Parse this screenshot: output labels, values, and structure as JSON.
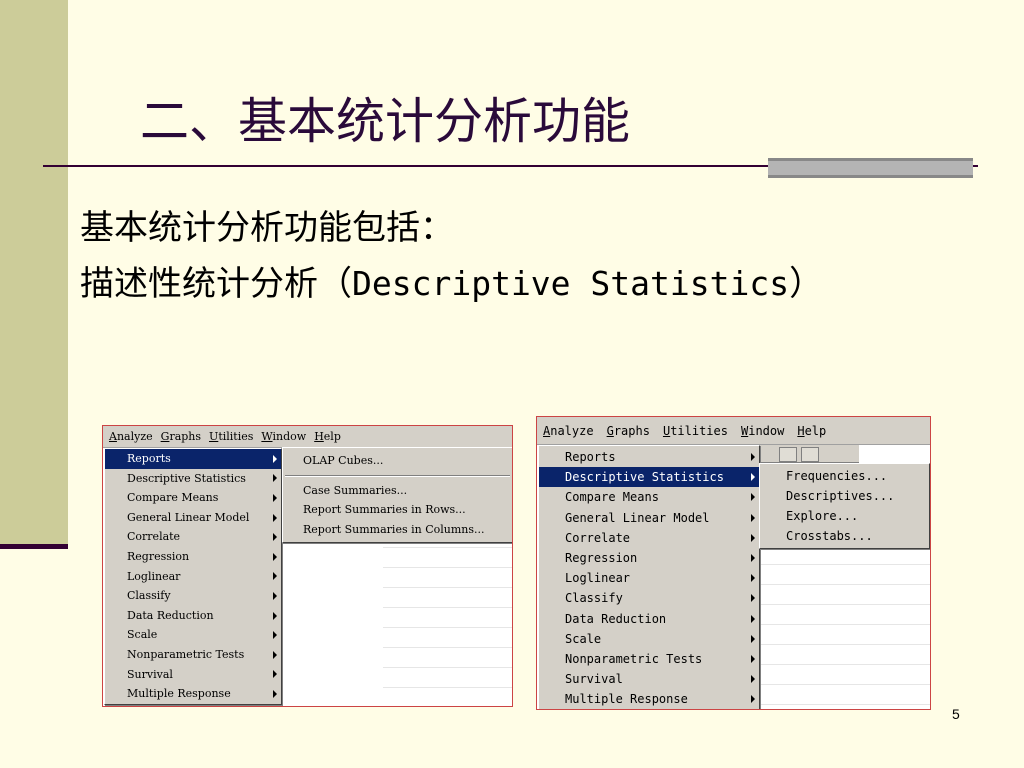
{
  "slide": {
    "title": "二、基本统计分析功能",
    "line1": "基本统计分析功能包括：",
    "line2_cn": "描述性统计分析（",
    "line2_en": "Descriptive Statistics",
    "line2_close": "）",
    "page_number": "5"
  },
  "screenshot_left": {
    "menubar": [
      "Analyze",
      "Graphs",
      "Utilities",
      "Window",
      "Help"
    ],
    "analyze_menu": [
      "Reports",
      "Descriptive Statistics",
      "Compare Means",
      "General Linear Model",
      "Correlate",
      "Regression",
      "Loglinear",
      "Classify",
      "Data Reduction",
      "Scale",
      "Nonparametric Tests",
      "Survival",
      "Multiple Response"
    ],
    "selected": "Reports",
    "submenu": [
      "OLAP Cubes...",
      "Case Summaries...",
      "Report Summaries in Rows...",
      "Report Summaries in Columns..."
    ]
  },
  "screenshot_right": {
    "menubar": [
      "Analyze",
      "Graphs",
      "Utilities",
      "Window",
      "Help"
    ],
    "analyze_menu": [
      "Reports",
      "Descriptive Statistics",
      "Compare Means",
      "General Linear Model",
      "Correlate",
      "Regression",
      "Loglinear",
      "Classify",
      "Data Reduction",
      "Scale",
      "Nonparametric Tests",
      "Survival",
      "Multiple Response"
    ],
    "selected": "Descriptive Statistics",
    "submenu": [
      "Frequencies...",
      "Descriptives...",
      "Explore...",
      "Crosstabs..."
    ]
  },
  "colors": {
    "background": "#fffde6",
    "left_bar": "#cccc99",
    "accent": "#330033",
    "menu_highlight": "#0a246a"
  }
}
